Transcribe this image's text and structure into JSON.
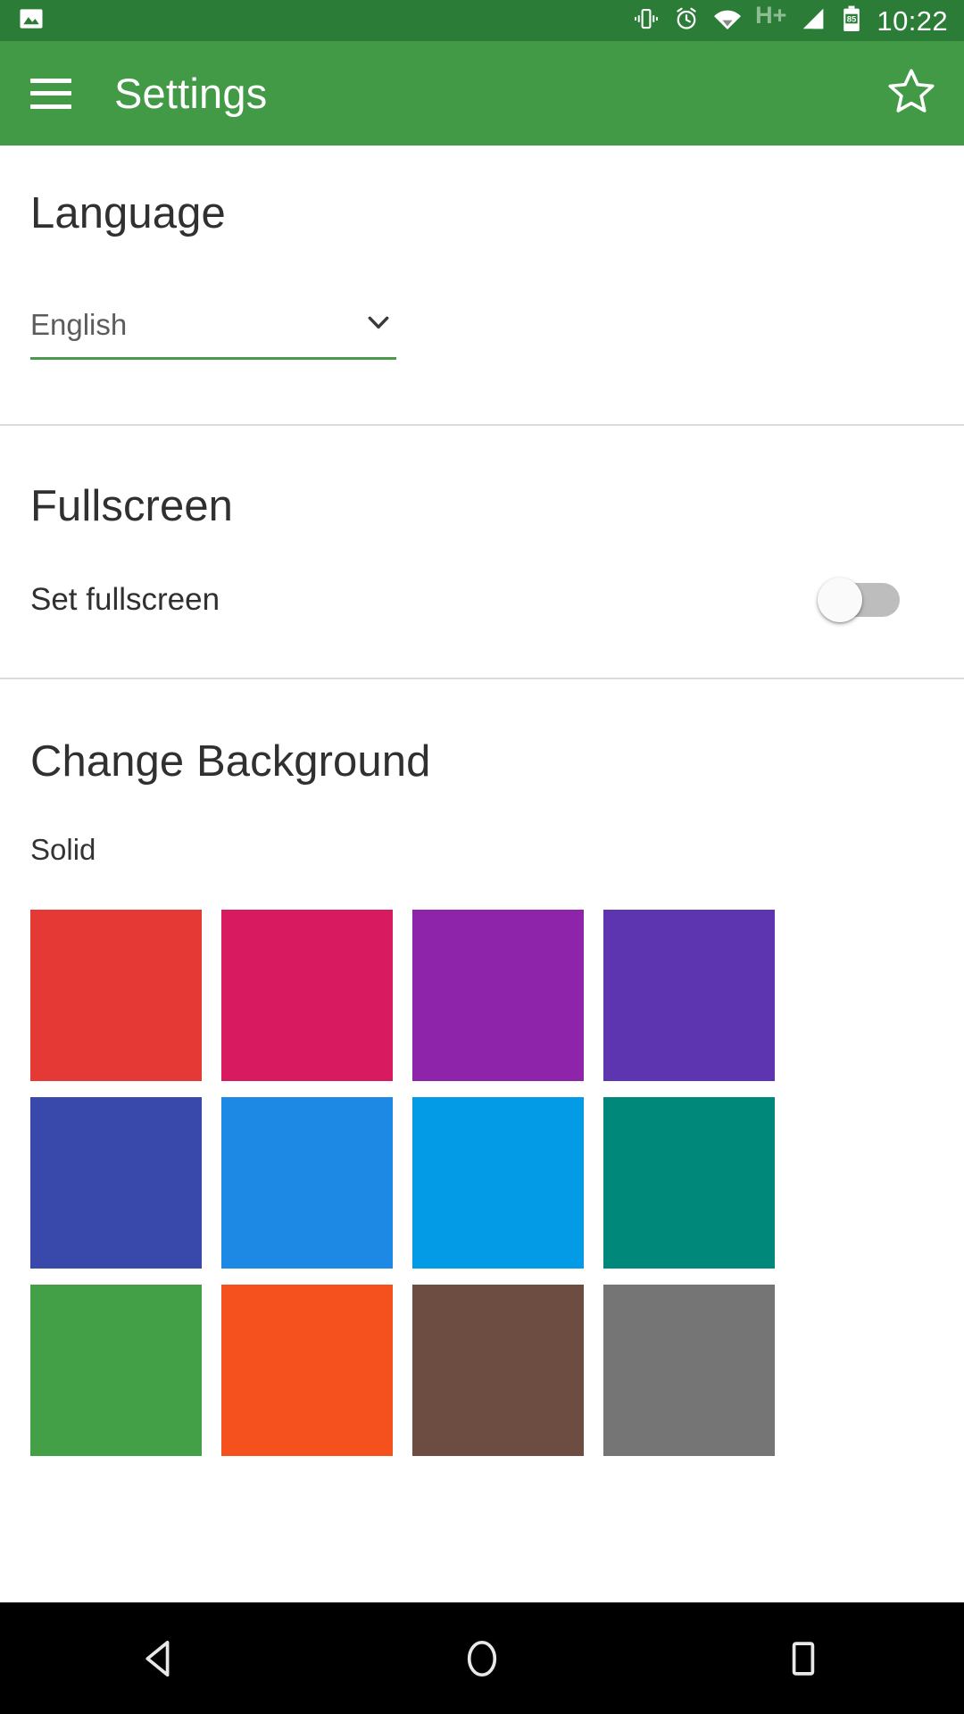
{
  "status_bar": {
    "background_color": "#2b7c36",
    "left_icons": [
      {
        "name": "photo-icon",
        "label": "Screenshot"
      }
    ],
    "right_icons": [
      {
        "name": "vibrate-icon",
        "label": "Vibrate"
      },
      {
        "name": "alarm-icon",
        "label": "Alarm"
      },
      {
        "name": "wifi-icon",
        "label": "Wi-Fi"
      }
    ],
    "network_type": "H+",
    "signal": "signal-icon",
    "battery_level": "85",
    "time": "10:22"
  },
  "app_bar": {
    "background_color": "#429a46",
    "menu_icon": "hamburger-menu-icon",
    "title": "Settings",
    "action_icon": "star-outline-icon"
  },
  "sections": {
    "language": {
      "title": "Language",
      "spinner_value": "English",
      "spinner_icon": "chevron-down-icon",
      "underline_color": "#4a9a4e"
    },
    "fullscreen": {
      "title": "Fullscreen",
      "switch_label": "Set fullscreen",
      "switch_state": "off",
      "switch_track_color": "#bdbdbd",
      "switch_thumb_color": "#fafafa"
    },
    "background": {
      "title": "Change Background",
      "sub_label": "Solid",
      "swatches": [
        {
          "name": "swatch-red",
          "color": "#e53935"
        },
        {
          "name": "swatch-pink",
          "color": "#d81b60"
        },
        {
          "name": "swatch-purple",
          "color": "#8e24aa"
        },
        {
          "name": "swatch-deep-purple",
          "color": "#5e35b1"
        },
        {
          "name": "swatch-indigo",
          "color": "#3949ab"
        },
        {
          "name": "swatch-blue",
          "color": "#1e88e5"
        },
        {
          "name": "swatch-light-blue",
          "color": "#039be5"
        },
        {
          "name": "swatch-teal",
          "color": "#00897b"
        },
        {
          "name": "swatch-green",
          "color": "#43a047"
        },
        {
          "name": "swatch-deep-orange",
          "color": "#f4511e"
        },
        {
          "name": "swatch-brown",
          "color": "#6d4c41"
        },
        {
          "name": "swatch-grey",
          "color": "#757575"
        }
      ]
    }
  },
  "nav_bar": {
    "background_color": "#000000",
    "buttons": [
      {
        "name": "nav-back-button",
        "label": "Back"
      },
      {
        "name": "nav-home-button",
        "label": "Home"
      },
      {
        "name": "nav-recents-button",
        "label": "Recents"
      }
    ]
  }
}
